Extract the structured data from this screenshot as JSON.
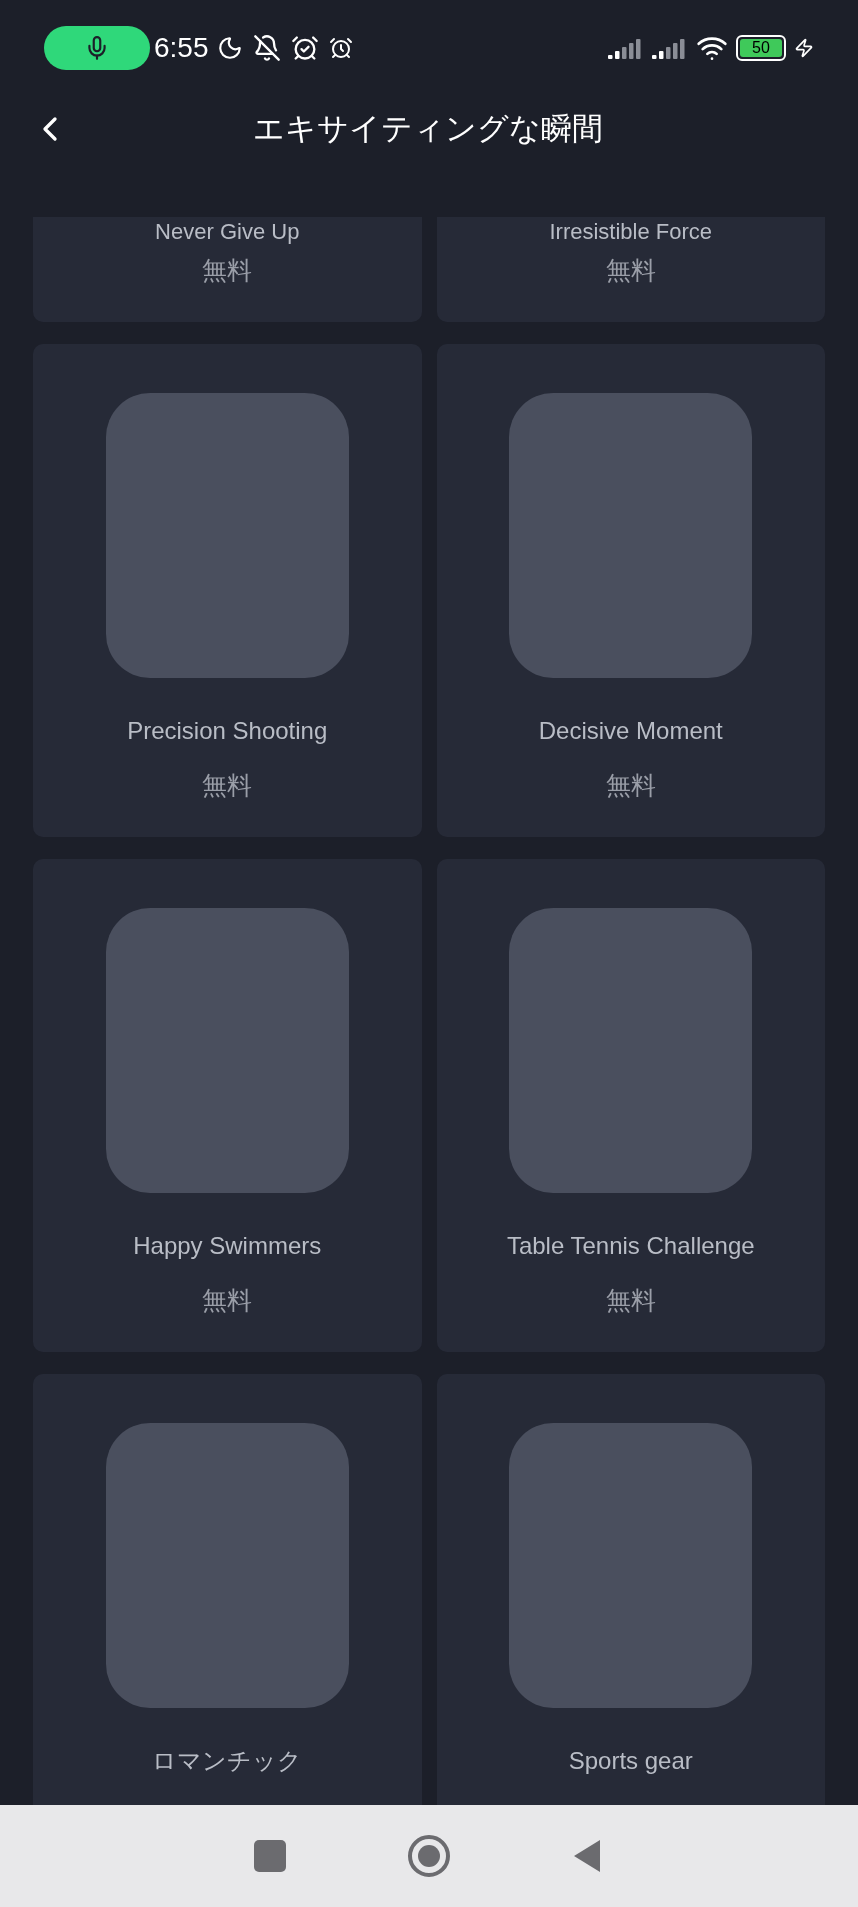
{
  "status_bar": {
    "time": "6:55",
    "battery": "50"
  },
  "header": {
    "title": "エキサイティングな瞬間"
  },
  "watch_faces": [
    {
      "kind": "cut",
      "name": "Never Give Up",
      "price": "無料"
    },
    {
      "kind": "cut",
      "name": "Irresistible Force",
      "price": "無料"
    },
    {
      "kind": "full",
      "name": "Precision Shooting",
      "price": "無料"
    },
    {
      "kind": "full",
      "name": "Decisive Moment",
      "price": "無料"
    },
    {
      "kind": "full",
      "name": "Happy Swimmers",
      "price": "無料"
    },
    {
      "kind": "full",
      "name": "Table Tennis Challenge",
      "price": "無料"
    },
    {
      "kind": "full",
      "name": "ロマンチック"
    },
    {
      "kind": "full",
      "name": "Sports gear"
    }
  ]
}
